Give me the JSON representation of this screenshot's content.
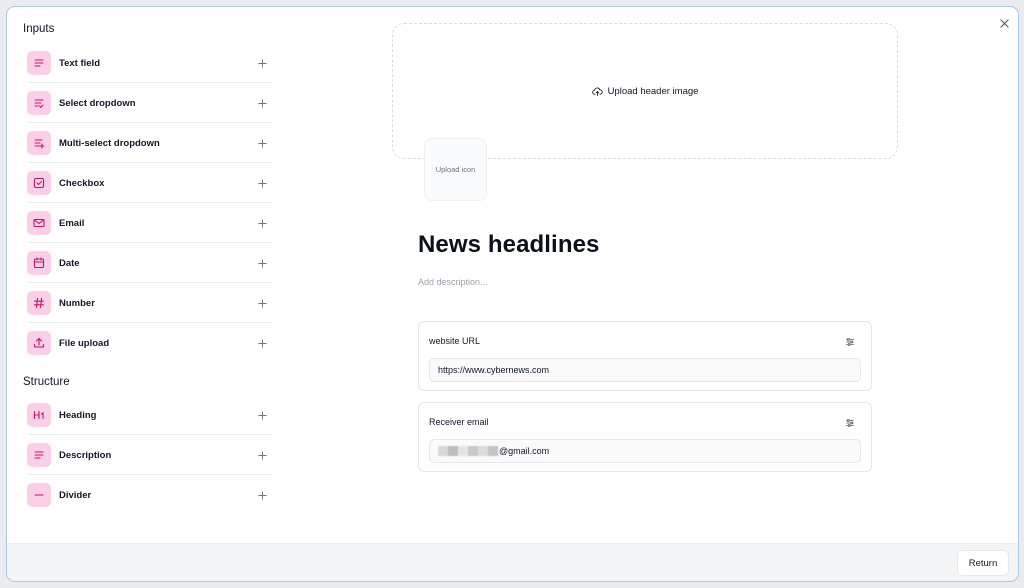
{
  "modal": {
    "close_icon": "close-icon"
  },
  "sidebar": {
    "inputs_title": "Inputs",
    "inputs": [
      {
        "label": "Text field",
        "icon": "text-lines-icon"
      },
      {
        "label": "Select dropdown",
        "icon": "list-check-icon"
      },
      {
        "label": "Multi-select dropdown",
        "icon": "list-plus-icon"
      },
      {
        "label": "Checkbox",
        "icon": "checkbox-icon"
      },
      {
        "label": "Email",
        "icon": "mail-icon"
      },
      {
        "label": "Date",
        "icon": "calendar-icon"
      },
      {
        "label": "Number",
        "icon": "hash-icon"
      },
      {
        "label": "File upload",
        "icon": "upload-icon"
      }
    ],
    "structure_title": "Structure",
    "structure": [
      {
        "label": "Heading",
        "icon": "heading-icon"
      },
      {
        "label": "Description",
        "icon": "text-lines-icon"
      },
      {
        "label": "Divider",
        "icon": "minus-icon"
      }
    ],
    "add_icon": "plus-icon",
    "icon_bg_color": "#fbcfe8",
    "icon_fg_color": "#be185d"
  },
  "form": {
    "header_upload_label": "Upload header image",
    "icon_upload_label": "Upload icon",
    "title": "News headlines",
    "description_placeholder": "Add description...",
    "fields": [
      {
        "label": "website URL",
        "value": "https://www.cybernews.com"
      },
      {
        "label": "Receiver email",
        "value": "@gmail.com"
      }
    ]
  },
  "footer": {
    "return_label": "Return"
  }
}
